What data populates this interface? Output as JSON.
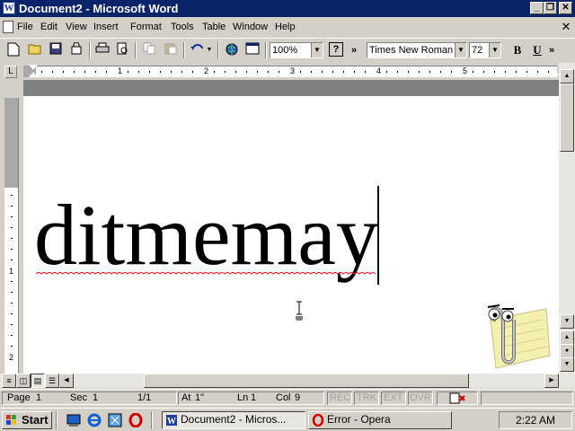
{
  "window": {
    "title": "Document2 - Microsoft Word",
    "app_icon": "W",
    "caption_buttons": {
      "minimize": "_",
      "restore": "❐",
      "close": "✕"
    }
  },
  "menubar": {
    "items": [
      "File",
      "Edit",
      "View",
      "Insert",
      "Format",
      "Tools",
      "Table",
      "Window",
      "Help"
    ],
    "close_glyph": "✕"
  },
  "toolbar": {
    "zoom": "100%",
    "help_glyph": "?",
    "font_name": "Times New Roman",
    "font_size": "72",
    "bold": "B",
    "underline": "U",
    "more_glyph": "»",
    "dropdown_glyph": "▼",
    "icons": [
      "new-document-icon",
      "open-folder-icon",
      "save-icon",
      "permission-icon",
      "print-icon",
      "print-preview-icon",
      "copy-icon",
      "paste-icon",
      "undo-icon",
      "web-icon",
      "document-map-icon"
    ]
  },
  "ruler": {
    "numbers": [
      "1",
      "2",
      "3",
      "4",
      "5"
    ],
    "tab_selector": "L"
  },
  "vertical_ruler": {
    "numbers": [
      "1",
      "2"
    ]
  },
  "document": {
    "text": "ditmemay"
  },
  "statusbar": {
    "page": "Page",
    "page_num": "1",
    "sec": "Sec",
    "sec_num": "1",
    "pages": "1/1",
    "at": "At",
    "at_val": "1\"",
    "ln": "Ln",
    "ln_val": "1",
    "col": "Col",
    "col_val": "9",
    "modes": [
      "REC",
      "TRK",
      "EXT",
      "OVR"
    ]
  },
  "taskbar": {
    "start": "Start",
    "quick_launch": [
      "desktop-icon",
      "internet-explorer-icon",
      "channels-icon",
      "opera-icon"
    ],
    "tasks": [
      {
        "label": "Document2 - Micros...",
        "active": true,
        "icon": "word-icon"
      },
      {
        "label": "Error - Opera",
        "active": false,
        "icon": "opera-icon"
      }
    ],
    "clock": "2:22 AM"
  },
  "colors": {
    "titlebar": "#0a246a",
    "chrome": "#d4d0c8",
    "page": "#ffffff",
    "spell_error": "#ff0000"
  }
}
